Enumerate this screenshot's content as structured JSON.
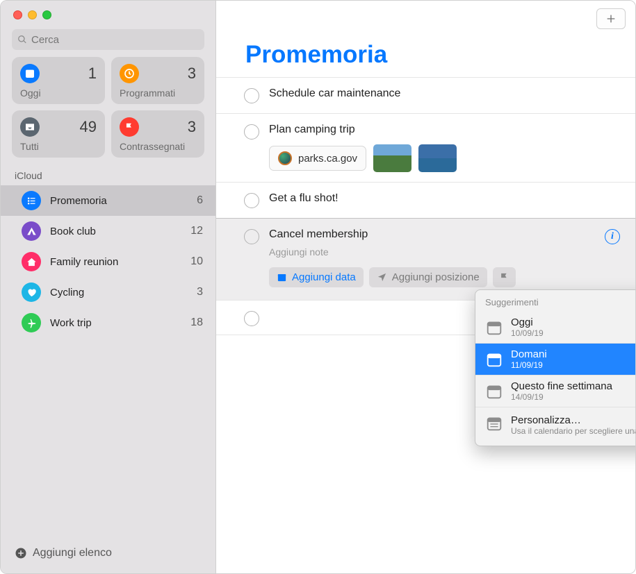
{
  "search": {
    "placeholder": "Cerca"
  },
  "smart_lists": {
    "today": {
      "label": "Oggi",
      "count": "1",
      "color": "#0a7aff"
    },
    "scheduled": {
      "label": "Programmati",
      "count": "3",
      "color": "#ff9500"
    },
    "all": {
      "label": "Tutti",
      "count": "49",
      "color": "#5b6670"
    },
    "flagged": {
      "label": "Contrassegnati",
      "count": "3",
      "color": "#ff3b30"
    }
  },
  "section": {
    "title": "iCloud"
  },
  "lists": [
    {
      "name": "Promemoria",
      "count": "6",
      "color": "#0a7aff",
      "icon": "list"
    },
    {
      "name": "Book club",
      "count": "12",
      "color": "#7a4cc9",
      "icon": "tent"
    },
    {
      "name": "Family reunion",
      "count": "10",
      "color": "#ff2d68",
      "icon": "house"
    },
    {
      "name": "Cycling",
      "count": "3",
      "color": "#1db6e6",
      "icon": "heart"
    },
    {
      "name": "Work trip",
      "count": "18",
      "color": "#2fcb55",
      "icon": "plane"
    }
  ],
  "add_list": {
    "label": "Aggiungi elenco"
  },
  "main": {
    "title": "Promemoria",
    "reminders": [
      {
        "title": "Schedule car maintenance"
      },
      {
        "title": "Plan camping trip",
        "link": "parks.ca.gov"
      },
      {
        "title": "Get a flu shot!"
      },
      {
        "title": "Cancel membership",
        "notes_placeholder": "Aggiungi note"
      }
    ],
    "chips": {
      "date": "Aggiungi data",
      "location": "Aggiungi posizione"
    }
  },
  "popover": {
    "title": "Suggerimenti",
    "items": [
      {
        "main": "Oggi",
        "sub": "10/09/19"
      },
      {
        "main": "Domani",
        "sub": "11/09/19"
      },
      {
        "main": "Questo fine settimana",
        "sub": "14/09/19"
      }
    ],
    "custom": {
      "main": "Personalizza…",
      "sub": "Usa il calendario per scegliere una data"
    }
  }
}
